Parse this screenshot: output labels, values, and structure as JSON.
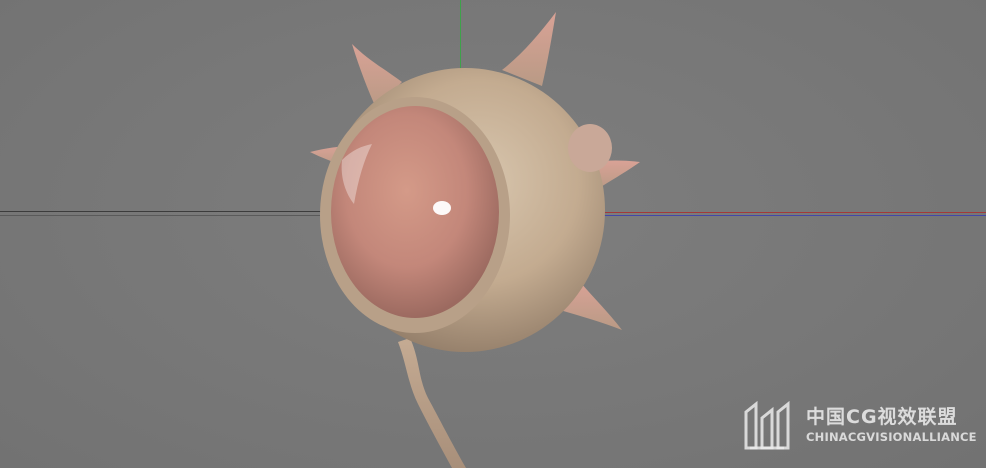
{
  "viewport": {
    "background_color": "#777777",
    "axis_colors": {
      "x_positive": "#a23a3a",
      "z": "#4446a8",
      "y": "#3ea24a",
      "x_negative": "#3c3c3c"
    }
  },
  "model": {
    "icon": "eyeball-creature-3d-model",
    "skin_color": "#c9b39a",
    "eye_color": "#c88a7a"
  },
  "watermark": {
    "logo_icon": "chinacg-logo-icon",
    "title_cn": "中国CG视效联盟",
    "title_en": "CHINACGVISIONALLIANCE"
  }
}
